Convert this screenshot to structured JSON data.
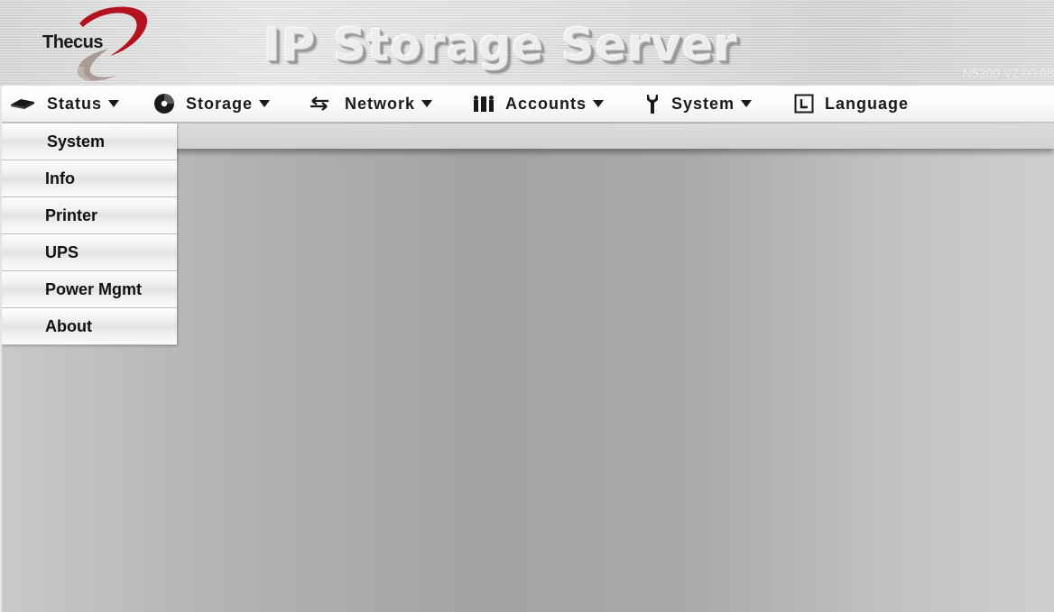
{
  "header": {
    "logo_text": "Thecus",
    "title": "IP Storage Server",
    "version": "N5200 V2.00.08"
  },
  "menu": {
    "items": [
      {
        "label": "Status",
        "icon": "hdd-icon",
        "has_caret": true
      },
      {
        "label": "Storage",
        "icon": "disk-icon",
        "has_caret": true
      },
      {
        "label": "Network",
        "icon": "network-arrows-icon",
        "has_caret": true
      },
      {
        "label": "Accounts",
        "icon": "users-icon",
        "has_caret": true
      },
      {
        "label": "System",
        "icon": "tool-icon",
        "has_caret": true
      },
      {
        "label": "Language",
        "icon": "language-icon",
        "has_caret": false
      }
    ]
  },
  "dropdown": {
    "items": [
      {
        "label": "System"
      },
      {
        "label": "Info"
      },
      {
        "label": "Printer"
      },
      {
        "label": "UPS"
      },
      {
        "label": "Power Mgmt"
      },
      {
        "label": "About"
      }
    ]
  },
  "colors": {
    "logo_red": "#b3121e",
    "logo_gray": "#a89a94",
    "menu_text": "#1a1a1a"
  }
}
